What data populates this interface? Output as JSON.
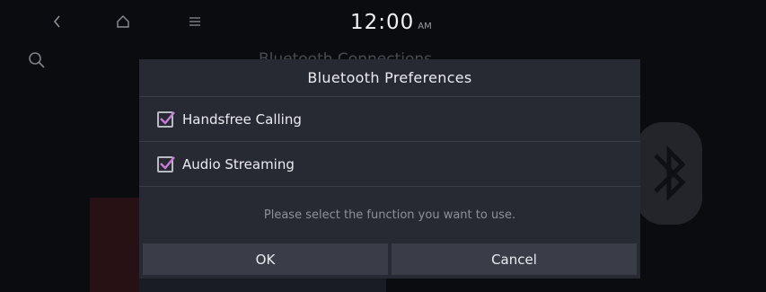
{
  "status_bar": {
    "time": "12:00",
    "ampm": "AM"
  },
  "background": {
    "title": "Bluetooth Connections"
  },
  "dialog": {
    "title": "Bluetooth Preferences",
    "options": [
      {
        "label": "Handsfree Calling",
        "checked": true
      },
      {
        "label": "Audio Streaming",
        "checked": true
      }
    ],
    "message": "Please select the function you want to use.",
    "ok_label": "OK",
    "cancel_label": "Cancel"
  },
  "colors": {
    "checkmark": "#c97bd8",
    "dialog_bg": "#272a33",
    "button_bg": "#3a3d48"
  }
}
